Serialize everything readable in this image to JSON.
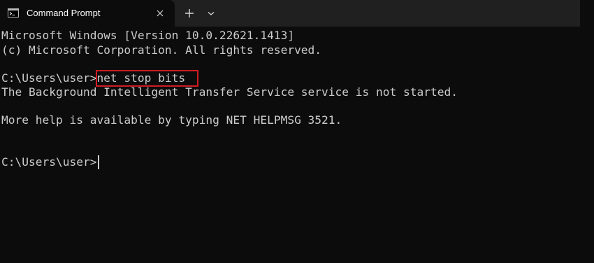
{
  "window": {
    "tab_title": "Command Prompt",
    "tab_icon": "cmd-icon",
    "close_icon": "close-icon",
    "new_tab_icon": "plus-icon",
    "dropdown_icon": "chevron-down-icon"
  },
  "console": {
    "lines": [
      "Microsoft Windows [Version 10.0.22621.1413]",
      "(c) Microsoft Corporation. All rights reserved.",
      "",
      "C:\\Users\\user>net stop bits",
      "The Background Intelligent Transfer Service service is not started.",
      "",
      "More help is available by typing NET HELPMSG 3521.",
      "",
      "",
      "C:\\Users\\user>"
    ],
    "prompt": "C:\\Users\\user>",
    "highlighted_command": "net stop bits",
    "current_input": ""
  },
  "colors": {
    "background": "#0c0c0c",
    "titlebar": "#202020",
    "text": "#cccccc",
    "highlight_box": "#d01b22"
  }
}
